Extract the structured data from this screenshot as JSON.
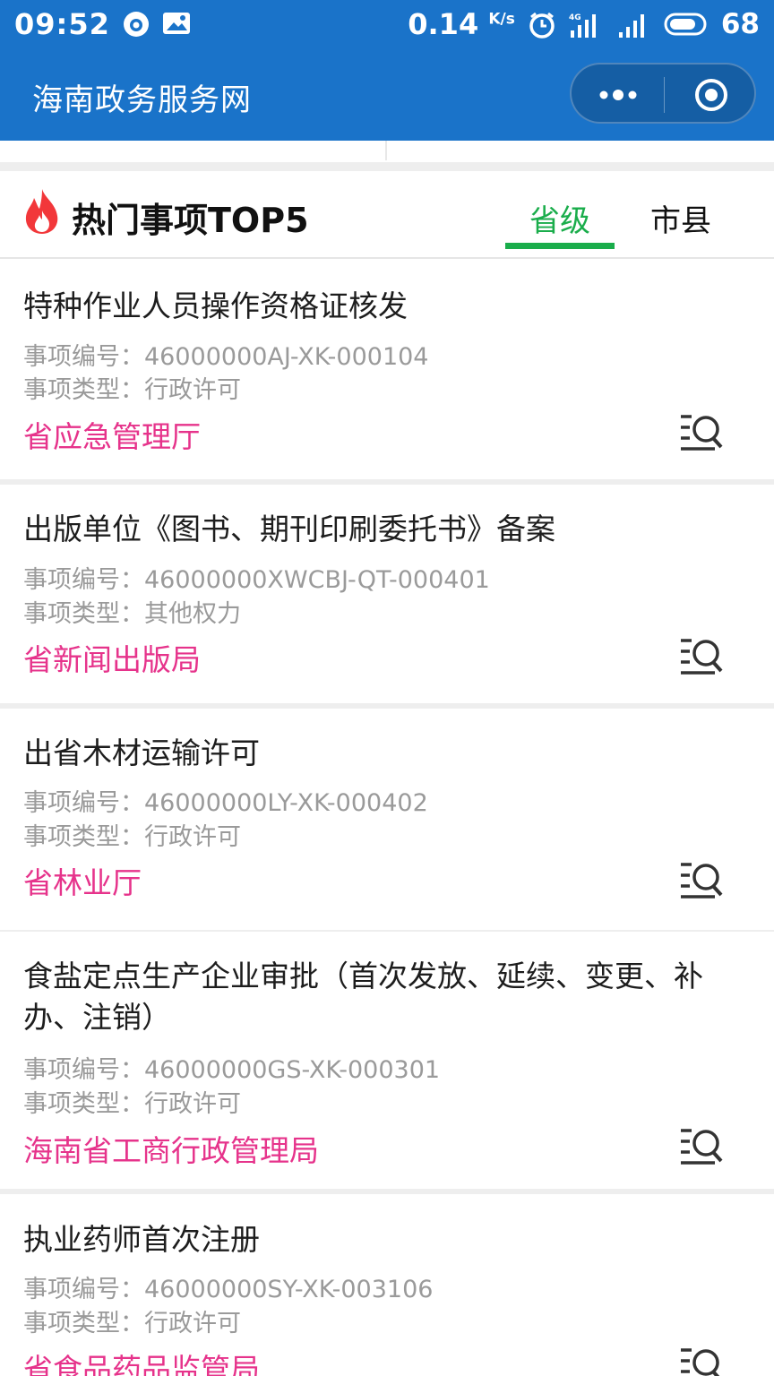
{
  "status_bar": {
    "time": "09:52",
    "speed_value": "0.14",
    "speed_unit": "K/s",
    "battery": "68",
    "network_label": "4G"
  },
  "nav": {
    "title": "海南政务服务网"
  },
  "section": {
    "title": "热门事项TOP5",
    "tabs": [
      "省级",
      "市县"
    ],
    "active_tab": "省级",
    "accent_color": "#1aad4b"
  },
  "items": [
    {
      "title": "特种作业人员操作资格证核发",
      "code_label": "事项编号：",
      "code": "46000000AJ-XK-000104",
      "type_label": "事项类型：",
      "type": "行政许可",
      "dept": "省应急管理厅"
    },
    {
      "title": "出版单位《图书、期刊印刷委托书》备案",
      "code_label": "事项编号：",
      "code": "46000000XWCBJ-QT-000401",
      "type_label": "事项类型：",
      "type": "其他权力",
      "dept": "省新闻出版局"
    },
    {
      "title": "出省木材运输许可",
      "code_label": "事项编号：",
      "code": "46000000LY-XK-000402",
      "type_label": "事项类型：",
      "type": "行政许可",
      "dept": "省林业厅"
    },
    {
      "title": "食盐定点生产企业审批（首次发放、延续、变更、补办、注销）",
      "code_label": "事项编号：",
      "code": "46000000GS-XK-000301",
      "type_label": "事项类型：",
      "type": "行政许可",
      "dept": "海南省工商行政管理局"
    },
    {
      "title": "执业药师首次注册",
      "code_label": "事项编号：",
      "code": "46000000SY-XK-003106",
      "type_label": "事项类型：",
      "type": "行政许可",
      "dept": "省食品药品监管局"
    }
  ],
  "colors": {
    "header_blue": "#1a73c9",
    "dept_pink": "#e6338b",
    "meta_gray": "#9a9a9a"
  }
}
